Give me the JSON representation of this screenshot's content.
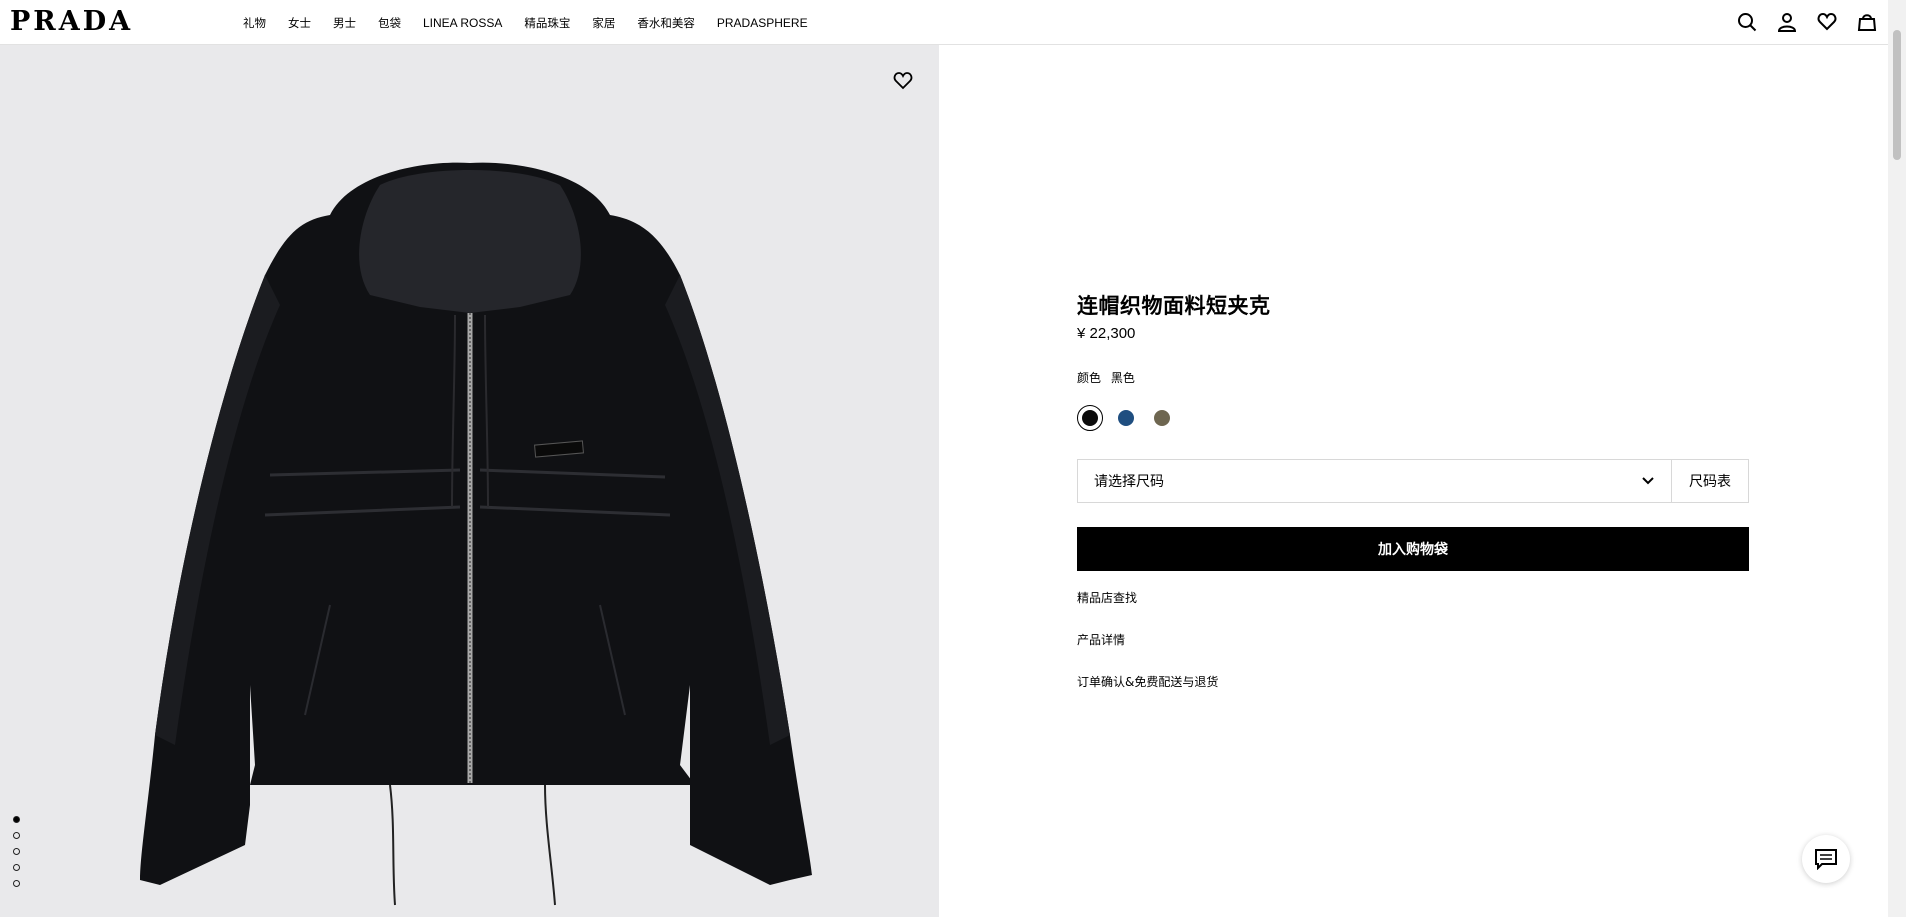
{
  "header": {
    "logo": "PRADA",
    "nav": [
      {
        "label": "礼物",
        "latin": false
      },
      {
        "label": "女士",
        "latin": false
      },
      {
        "label": "男士",
        "latin": false
      },
      {
        "label": "包袋",
        "latin": false
      },
      {
        "label": "LINEA ROSSA",
        "latin": true
      },
      {
        "label": "精品珠宝",
        "latin": false
      },
      {
        "label": "家居",
        "latin": false
      },
      {
        "label": "香水和美容",
        "latin": false
      },
      {
        "label": "PRADASPHERE",
        "latin": true
      }
    ],
    "icons": [
      "search-icon",
      "account-icon",
      "wishlist-icon",
      "bag-icon"
    ]
  },
  "gallery": {
    "image_count": 5,
    "active_index": 0,
    "wishlist_icon": "heart-icon"
  },
  "product": {
    "title": "连帽织物面料短夹克",
    "price": "¥ 22,300",
    "color_label": "颜色",
    "color_value": "黑色",
    "swatches": [
      {
        "name": "black",
        "color": "#0b0b0b",
        "selected": true
      },
      {
        "name": "blue",
        "color": "#1f4e80",
        "selected": false
      },
      {
        "name": "olive",
        "color": "#6e6650",
        "selected": false
      }
    ],
    "size_placeholder": "请选择尺码",
    "size_chart_label": "尺码表",
    "add_to_bag_label": "加入购物袋",
    "links": {
      "store": "精品店查找",
      "details": "产品详情",
      "shipping": "订单确认&免费配送与退货"
    }
  },
  "chat": {
    "icon": "chat-icon"
  }
}
